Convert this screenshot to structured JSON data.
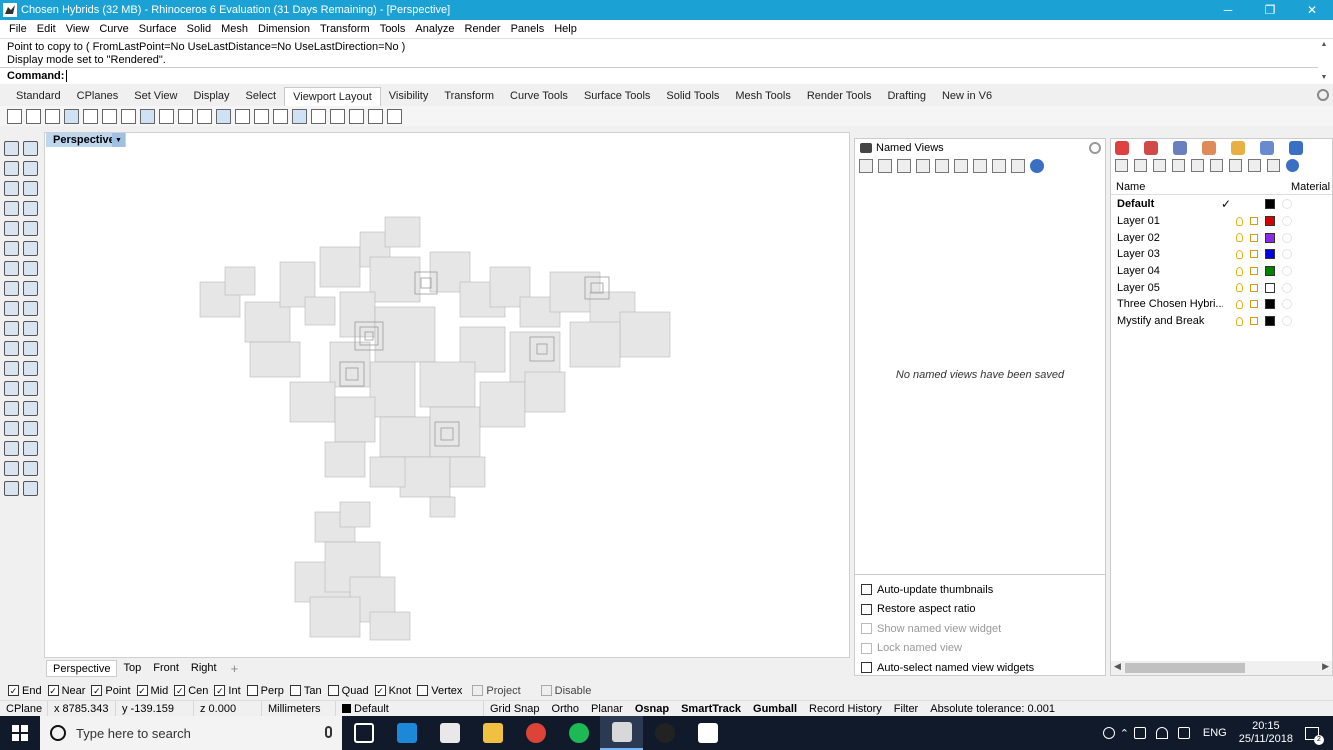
{
  "window": {
    "title": "Chosen Hybrids (32 MB) - Rhinoceros 6 Evaluation (31 Days Remaining) - [Perspective]",
    "minimize": "─",
    "restore": "❐",
    "close": "✕"
  },
  "menu": [
    "File",
    "Edit",
    "View",
    "Curve",
    "Surface",
    "Solid",
    "Mesh",
    "Dimension",
    "Transform",
    "Tools",
    "Analyze",
    "Render",
    "Panels",
    "Help"
  ],
  "command": {
    "history": [
      "Point to copy to ( FromLastPoint=No  UseLastDistance=No  UseLastDirection=No )",
      "Display mode set to \"Rendered\"."
    ],
    "label": "Command:"
  },
  "toolbar_tabs": [
    "Standard",
    "CPlanes",
    "Set View",
    "Display",
    "Select",
    "Viewport Layout",
    "Visibility",
    "Transform",
    "Curve Tools",
    "Surface Tools",
    "Solid Tools",
    "Mesh Tools",
    "Render Tools",
    "Drafting",
    "New in V6"
  ],
  "active_toolbar_tab": "Viewport Layout",
  "viewport": {
    "name": "Perspective",
    "tabs": [
      "Perspective",
      "Top",
      "Front",
      "Right"
    ],
    "add_tab": "+"
  },
  "named_views": {
    "title": "Named Views",
    "empty_message": "No named views have been saved",
    "options": [
      {
        "label": "Auto-update thumbnails",
        "enabled": true
      },
      {
        "label": "Restore aspect ratio",
        "enabled": true
      },
      {
        "label": "Show named view widget",
        "enabled": false
      },
      {
        "label": "Lock named view",
        "enabled": false
      },
      {
        "label": "Auto-select named view widgets",
        "enabled": true
      }
    ]
  },
  "layers": {
    "col_name": "Name",
    "col_material": "Material",
    "items": [
      {
        "name": "Default",
        "current": true,
        "color": "#000000"
      },
      {
        "name": "Layer 01",
        "current": false,
        "color": "#d40000"
      },
      {
        "name": "Layer 02",
        "current": false,
        "color": "#8a2be2"
      },
      {
        "name": "Layer 03",
        "current": false,
        "color": "#0000e0"
      },
      {
        "name": "Layer 04",
        "current": false,
        "color": "#008000"
      },
      {
        "name": "Layer 05",
        "current": false,
        "color": "#ffffff"
      },
      {
        "name": "Three Chosen Hybri...",
        "current": false,
        "color": "#000000"
      },
      {
        "name": "Mystify and Break",
        "current": false,
        "color": "#000000"
      }
    ]
  },
  "osnaps": [
    {
      "label": "End",
      "checked": true
    },
    {
      "label": "Near",
      "checked": true
    },
    {
      "label": "Point",
      "checked": true
    },
    {
      "label": "Mid",
      "checked": true
    },
    {
      "label": "Cen",
      "checked": true
    },
    {
      "label": "Int",
      "checked": true
    },
    {
      "label": "Perp",
      "checked": false
    },
    {
      "label": "Tan",
      "checked": false
    },
    {
      "label": "Quad",
      "checked": false
    },
    {
      "label": "Knot",
      "checked": true
    },
    {
      "label": "Vertex",
      "checked": false
    },
    {
      "label": "Project",
      "checked": false
    },
    {
      "label": "Disable",
      "checked": false
    }
  ],
  "status": {
    "cplane": "CPlane",
    "x": "x 8785.343",
    "y": "y -139.159",
    "z": "z 0.000",
    "units": "Millimeters",
    "layer": "Default",
    "grid_snap": "Grid Snap",
    "ortho": "Ortho",
    "planar": "Planar",
    "osnap": "Osnap",
    "smarttrack": "SmartTrack",
    "gumball": "Gumball",
    "record_history": "Record History",
    "filter": "Filter",
    "tolerance": "Absolute tolerance: 0.001"
  },
  "taskbar": {
    "search_placeholder": "Type here to search",
    "language": "ENG",
    "time": "20:15",
    "date": "25/11/2018",
    "notifications": "2"
  },
  "colors": {
    "titlebar": "#1ba1d4",
    "viewport_label": "#bdd7ee",
    "taskbar": "#101a2a"
  }
}
